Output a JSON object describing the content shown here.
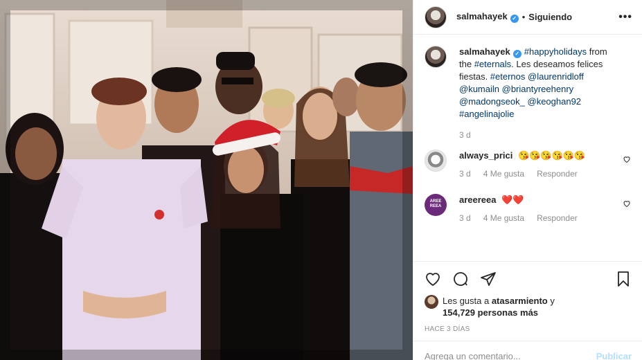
{
  "post": {
    "username": "salmahayek",
    "verified_mark": "✓",
    "separator": "•",
    "follow_status": "Siguiendo",
    "more_icon": "more-horizontal-icon"
  },
  "caption": {
    "username": "salmahayek",
    "segments": [
      {
        "text": "#happyholidays",
        "tag": true
      },
      {
        "text": " from the ",
        "tag": false
      },
      {
        "text": "#eternals",
        "tag": true
      },
      {
        "text": ". Les deseamos felices fiestas. ",
        "tag": false
      },
      {
        "text": "#eternos",
        "tag": true
      },
      {
        "text": " ",
        "tag": false
      },
      {
        "text": "@laurenridloff",
        "tag": true
      },
      {
        "text": " ",
        "tag": false
      },
      {
        "text": "@kumailn",
        "tag": true
      },
      {
        "text": " ",
        "tag": false
      },
      {
        "text": "@briantyreehenry",
        "tag": true
      },
      {
        "text": " ",
        "tag": false
      },
      {
        "text": "@madongseok_",
        "tag": true
      },
      {
        "text": " ",
        "tag": false
      },
      {
        "text": "@keoghan92",
        "tag": true
      },
      {
        "text": " ",
        "tag": false
      },
      {
        "text": "#angelinajolie",
        "tag": true
      }
    ],
    "time": "3 d"
  },
  "comments": [
    {
      "username": "always_prici",
      "text": "😘😘😘😘😘😘",
      "time": "3 d",
      "likes": "4 Me gusta",
      "reply": "Responder"
    },
    {
      "username": "areereea",
      "text": "❤️❤️",
      "time": "3 d",
      "likes": "4 Me gusta",
      "reply": "Responder",
      "avatar_text": "AREE REEA"
    }
  ],
  "likes": {
    "prefix": "Les gusta a ",
    "user": "atasarmiento",
    "middle": " y",
    "count": "154,729 personas más"
  },
  "date": "HACE 3 DÍAS",
  "add_comment": {
    "placeholder": "Agrega un comentario...",
    "publish": "Publicar"
  },
  "colors": {
    "link": "#00376b",
    "verified": "#3897f0",
    "muted": "#8e8e8e",
    "publish_disabled": "#b2dffc"
  }
}
